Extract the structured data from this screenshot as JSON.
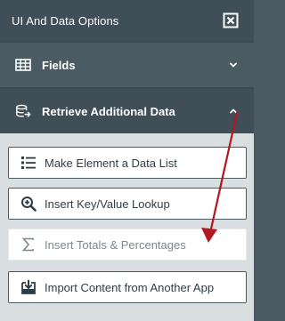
{
  "header": {
    "title": "UI And Data Options",
    "close_icon": "close-box-icon"
  },
  "sections": [
    {
      "label": "Fields",
      "icon": "table-icon",
      "state": "collapsed",
      "chevron": "chevron-down-icon"
    },
    {
      "label": "Retrieve Additional Data",
      "icon": "database-arrow-icon",
      "state": "expanded",
      "chevron": "chevron-up-icon"
    }
  ],
  "options": [
    {
      "label": "Make Element a Data List",
      "icon": "list-icon",
      "enabled": true
    },
    {
      "label": "Insert Key/Value Lookup",
      "icon": "magnify-plus-icon",
      "enabled": true
    },
    {
      "label": "Insert Totals & Percentages",
      "icon": "sigma-icon",
      "enabled": false
    },
    {
      "label": "Import Content from Another App",
      "icon": "import-icon",
      "enabled": true
    }
  ],
  "annotation": {
    "type": "arrow",
    "color": "#b3171f"
  }
}
